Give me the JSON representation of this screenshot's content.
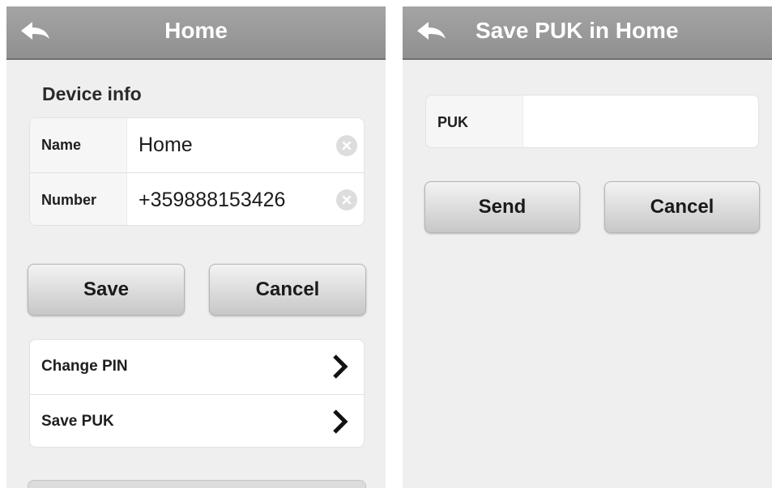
{
  "left_screen": {
    "navbar": {
      "title": "Home",
      "back_icon": "back-arrow-icon"
    },
    "device_info": {
      "section_title": "Device info",
      "name_label": "Name",
      "name_value": "Home",
      "number_label": "Number",
      "number_value": "+359888153426"
    },
    "buttons": {
      "save": "Save",
      "cancel": "Cancel"
    },
    "menu": [
      {
        "label": "Change PIN",
        "icon": "chevron-right-icon"
      },
      {
        "label": "Save PUK",
        "icon": "chevron-right-icon"
      }
    ]
  },
  "right_screen": {
    "navbar": {
      "title": "Save PUK in Home",
      "back_icon": "back-arrow-icon"
    },
    "puk_field": {
      "label": "PUK",
      "value": ""
    },
    "buttons": {
      "send": "Send",
      "cancel": "Cancel"
    }
  },
  "colors": {
    "navbar": "#9a9a9a",
    "background": "#efefef",
    "card": "#ffffff",
    "button_top": "#f3f3f3",
    "button_bottom": "#c7c7c7"
  }
}
